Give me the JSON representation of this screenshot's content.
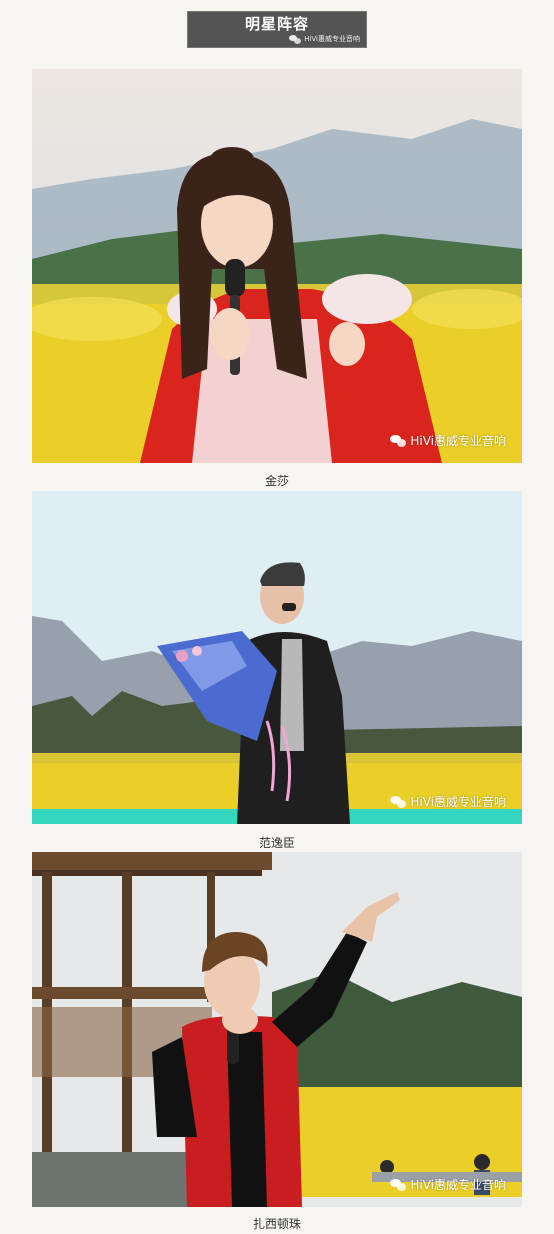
{
  "header": {
    "title": "明星阵容",
    "source": "HiVi惠威专业音响"
  },
  "photos": [
    {
      "caption": "金莎",
      "watermark": "HiVi惠威专业音响"
    },
    {
      "caption": "范逸臣",
      "watermark": "HiVi惠威专业音响"
    },
    {
      "caption": "扎西顿珠",
      "watermark": "HiVi惠威专业音响"
    }
  ],
  "colors": {
    "banner": "#545454",
    "rapeseed_yellow": "#e9cf28",
    "sky": "#dfeef2",
    "red_cape": "#d9251e"
  }
}
